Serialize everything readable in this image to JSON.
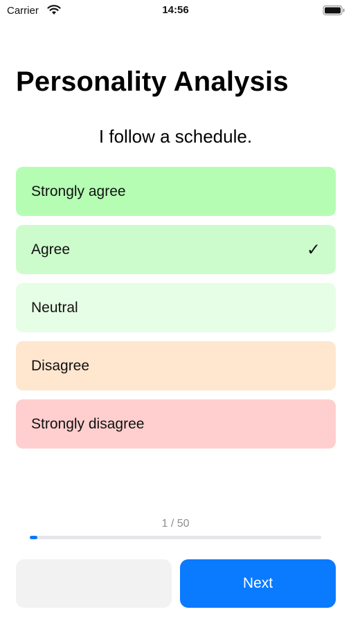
{
  "status_bar": {
    "carrier": "Carrier",
    "time": "14:56",
    "wifi_icon": "wifi-icon",
    "battery_icon": "battery-icon"
  },
  "title": "Personality Analysis",
  "question": "I follow a schedule.",
  "options": [
    {
      "label": "Strongly agree",
      "color": "#b5fdb3",
      "selected": false
    },
    {
      "label": "Agree",
      "color": "#cdfccc",
      "selected": true
    },
    {
      "label": "Neutral",
      "color": "#e6fee5",
      "selected": false
    },
    {
      "label": "Disagree",
      "color": "#fee6cf",
      "selected": false
    },
    {
      "label": "Strongly disagree",
      "color": "#fecfce",
      "selected": false
    }
  ],
  "check_icon": "✓",
  "progress": {
    "text": "1 / 50",
    "current": 1,
    "total": 50,
    "accent": "#0a7aff"
  },
  "buttons": {
    "previous_label": "",
    "next_label": "Next"
  }
}
